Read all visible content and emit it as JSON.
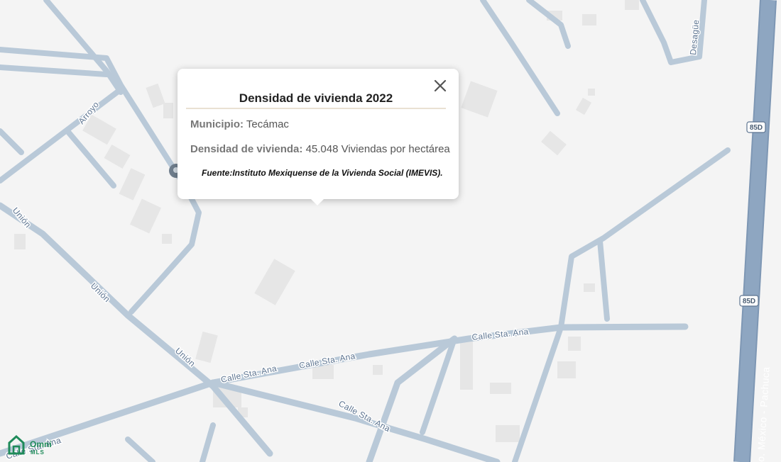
{
  "popup": {
    "title": "Densidad de vivienda 2022",
    "municipio_label": "Municipio:",
    "municipio_value": "Tecámac",
    "densidad_label": "Densidad de vivienda:",
    "densidad_value": "45.048 Viviendas por hectárea",
    "source": "Fuente:Instituto Mexiquense de la Vivienda Social (IMEVIS).",
    "close_icon": "close-icon"
  },
  "map": {
    "labels": {
      "arroyo": "Arroyo",
      "union_1": "Unión",
      "union_2": "Unión",
      "union_3": "Unión",
      "desague": "Desagüe",
      "calle_sta_ana_1": "Calle Sta. Ana",
      "calle_sta_ana_2": "Calle Sta. Ana",
      "calle_sta_ana_3": "Calle Sta. Ana",
      "calle_sta_ana_4": "Calle Sta. Ana",
      "calle_sta_ana_5": "Calle Sta. Ana",
      "highway": "o. México - Pachuca",
      "shield_1": "85D",
      "shield_2": "85D"
    },
    "colors": {
      "background": "#f4f4f4",
      "road": "#b9c9d8",
      "highway": "#8ea6c1",
      "building": "#e6e6e6"
    }
  },
  "logo": {
    "line1": "Omni",
    "line2": "MLS"
  }
}
